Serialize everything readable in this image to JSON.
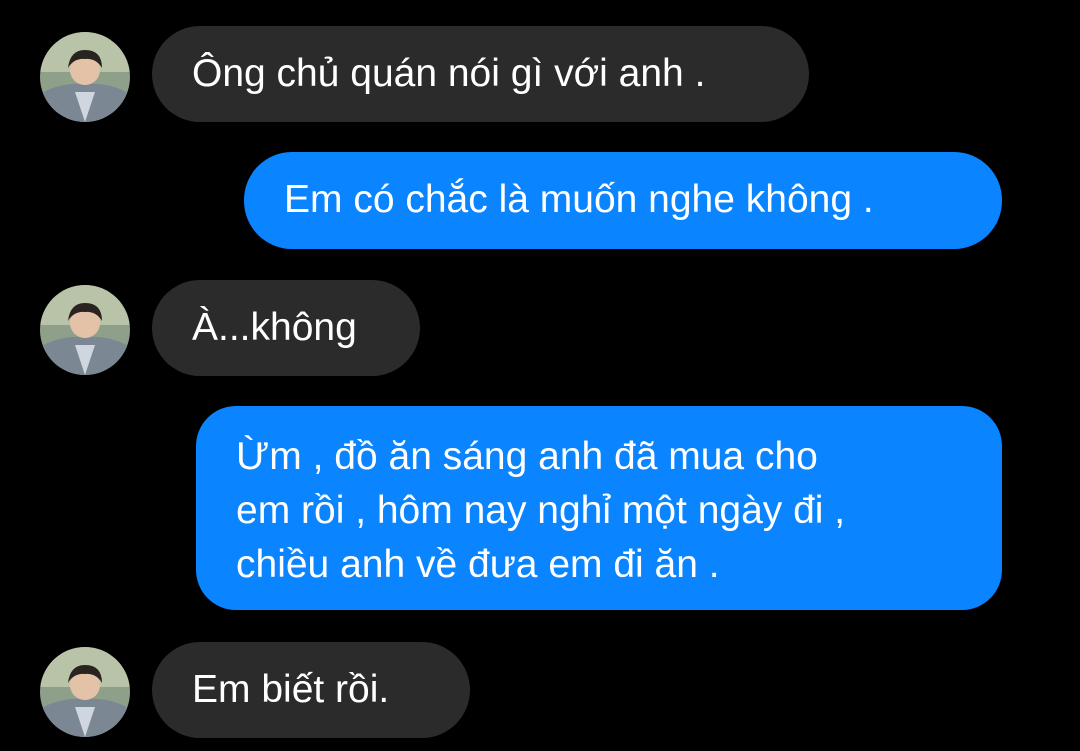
{
  "conversation": {
    "colors": {
      "background": "#000000",
      "incoming_bubble": "#2b2b2b",
      "outgoing_bubble": "#0a84ff",
      "text": "#ffffff"
    },
    "contact_avatar_icon": "profile-photo",
    "messages": [
      {
        "direction": "incoming",
        "text": "Ông chủ quán nói gì với anh ."
      },
      {
        "direction": "outgoing",
        "text": "Em có chắc là muốn nghe không ."
      },
      {
        "direction": "incoming",
        "text": "À...không"
      },
      {
        "direction": "outgoing",
        "lines": [
          "Ừm , đồ ăn sáng anh đã mua cho",
          "em rồi , hôm nay nghỉ một ngày đi ,",
          "chiều anh về đưa em đi ăn ."
        ]
      },
      {
        "direction": "incoming",
        "text": "Em biết rồi."
      }
    ]
  }
}
